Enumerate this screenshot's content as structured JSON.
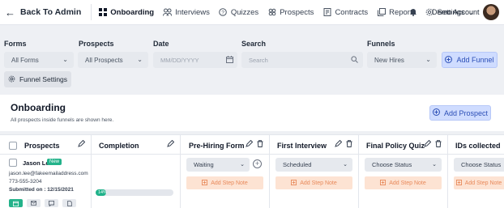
{
  "nav": {
    "back_label": "Back To Admin",
    "items": [
      {
        "label": "Onboarding",
        "icon": "grid-icon"
      },
      {
        "label": "Interviews",
        "icon": "users-icon"
      },
      {
        "label": "Quizzes",
        "icon": "question-icon"
      },
      {
        "label": "Prospects",
        "icon": "prospects-icon"
      },
      {
        "label": "Contracts",
        "icon": "contract-icon"
      },
      {
        "label": "Reports",
        "icon": "reports-icon"
      },
      {
        "label": "Settings",
        "icon": "gear-icon"
      }
    ],
    "account_label": "Demo Account"
  },
  "filters": {
    "forms": {
      "label": "Forms",
      "value": "All Forms"
    },
    "prospects": {
      "label": "Prospects",
      "value": "All Prospects"
    },
    "date": {
      "label": "Date",
      "placeholder": "MM/DD/YYYY"
    },
    "search": {
      "label": "Search",
      "placeholder": "Search"
    },
    "funnels": {
      "label": "Funnels",
      "value": "New Hires"
    },
    "add_funnel_label": "Add Funnel",
    "funnel_settings_label": "Funnel Settings"
  },
  "panel": {
    "title": "Onboarding",
    "subtitle": "All prospects inside funnels are shown here.",
    "add_prospect_label": "Add Prospect"
  },
  "table": {
    "columns": [
      {
        "label": "Prospects"
      },
      {
        "label": "Completion"
      },
      {
        "label": "Pre-Hiring Form"
      },
      {
        "label": "First Interview"
      },
      {
        "label": "Final Policy Quiz"
      },
      {
        "label": "IDs collected"
      }
    ],
    "row": {
      "name": "Jason Lee",
      "badge": "New",
      "email": "jason.lee@fakeemailaddress.com",
      "phone": "773-555-3204",
      "submitted": "Submitted on : 12/15/2021",
      "completion": 14,
      "completion_label": "14%",
      "statuses": [
        "Waiting",
        "Scheduled",
        "Choose Status",
        "Choose Status"
      ],
      "add_note_label": "Add Step Note"
    }
  },
  "colors": {
    "accent": "#2c4fb6",
    "success": "#20b28a",
    "note": "#fde3d3"
  }
}
